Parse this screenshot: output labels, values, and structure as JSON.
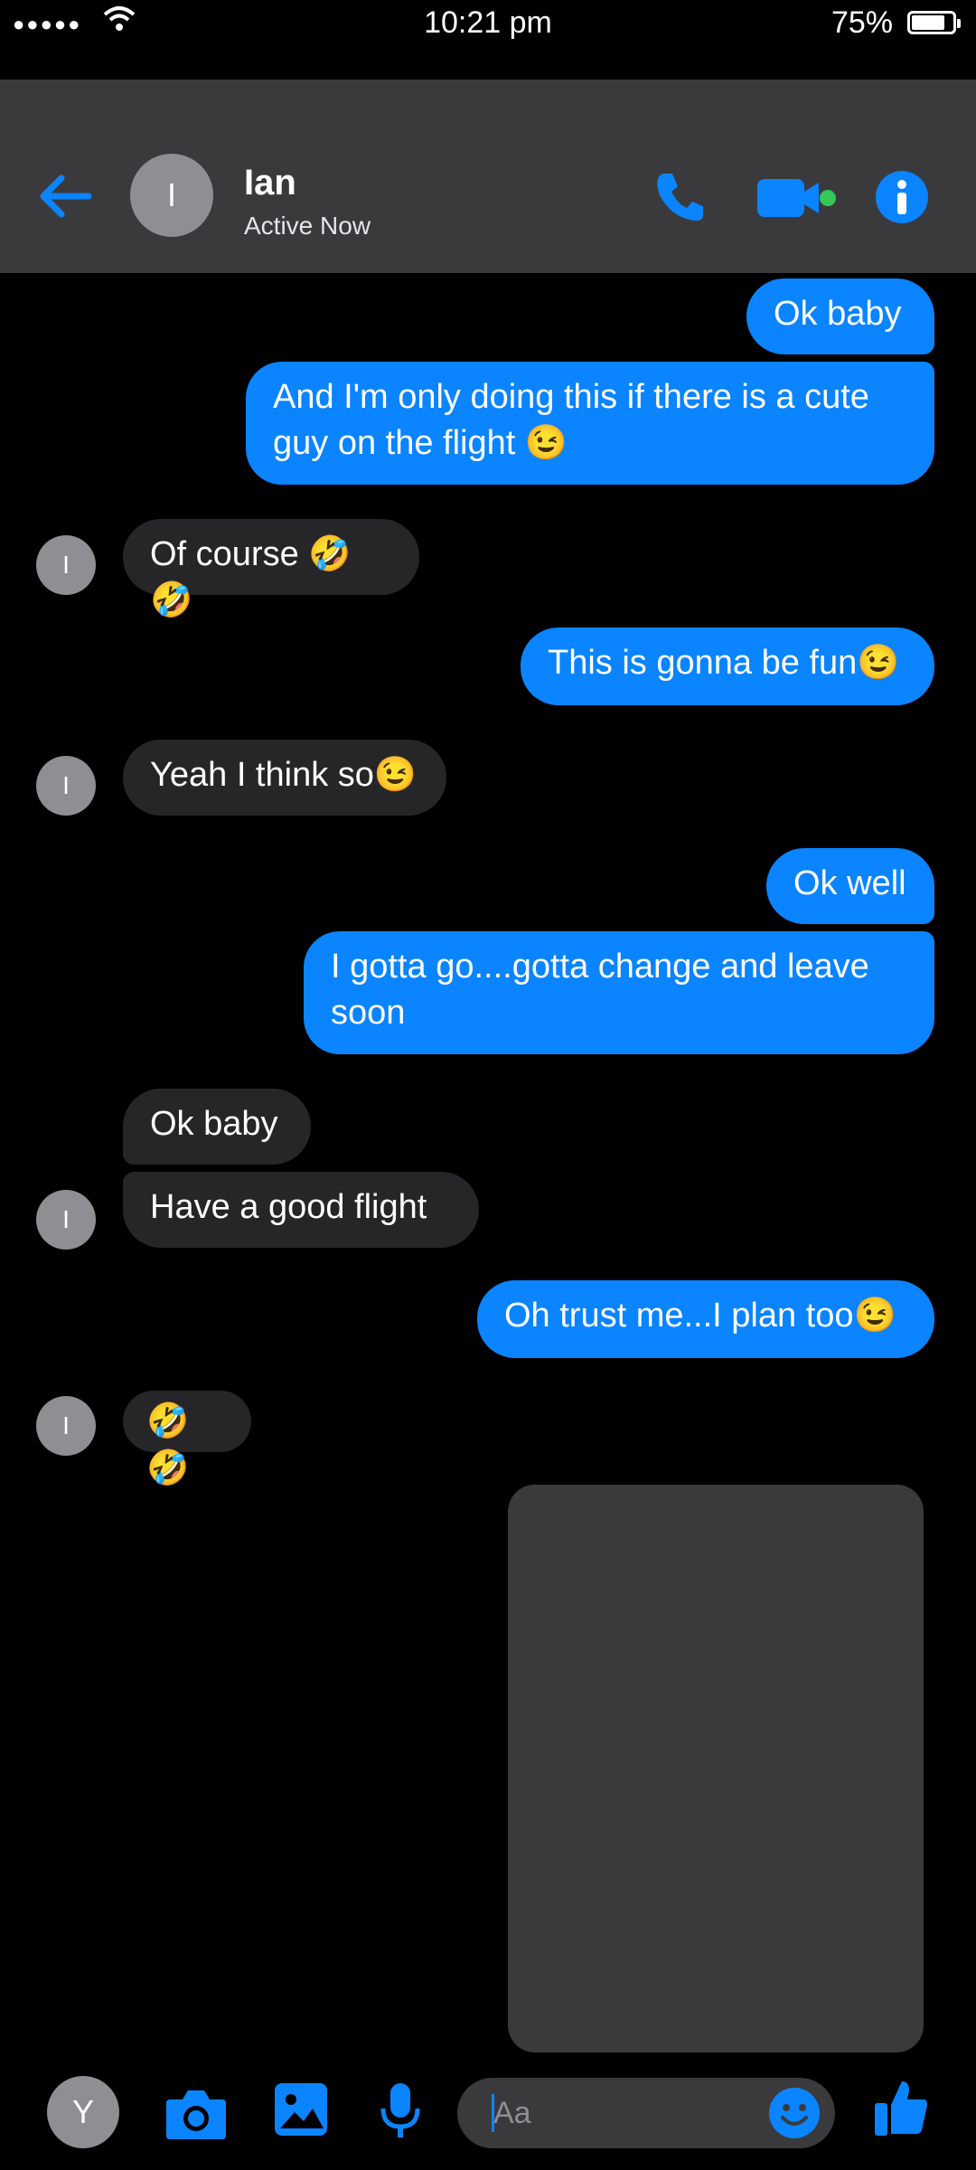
{
  "status_bar": {
    "time": "10:21 pm",
    "battery": "75%"
  },
  "header": {
    "avatar_initial": "I",
    "name": "Ian",
    "status": "Active Now"
  },
  "messages": [
    {
      "from": "me",
      "text": "Ok baby"
    },
    {
      "from": "me",
      "text": "And I'm only doing this if there is a cute guy on the flight 😉"
    },
    {
      "from": "them",
      "text": "Of course 🤣🤣"
    },
    {
      "from": "me",
      "text": "This is gonna be fun😉"
    },
    {
      "from": "them",
      "text": "Yeah I think so😉"
    },
    {
      "from": "me",
      "text": "Ok well"
    },
    {
      "from": "me",
      "text": "I gotta go....gotta change and leave soon"
    },
    {
      "from": "them",
      "text": "Ok baby"
    },
    {
      "from": "them",
      "text": "Have a good flight"
    },
    {
      "from": "me",
      "text": "Oh trust me...I plan too😉"
    },
    {
      "from": "them",
      "text": "🤣🤣"
    }
  ],
  "thread_avatar_initial": "I",
  "photo_placeholder": "",
  "composer": {
    "avatar_initial": "Y",
    "placeholder": "Aa"
  },
  "colors": {
    "accent": "#0a84ff",
    "header": "#3a3a3c",
    "incoming": "#262629",
    "online": "#34c759"
  }
}
